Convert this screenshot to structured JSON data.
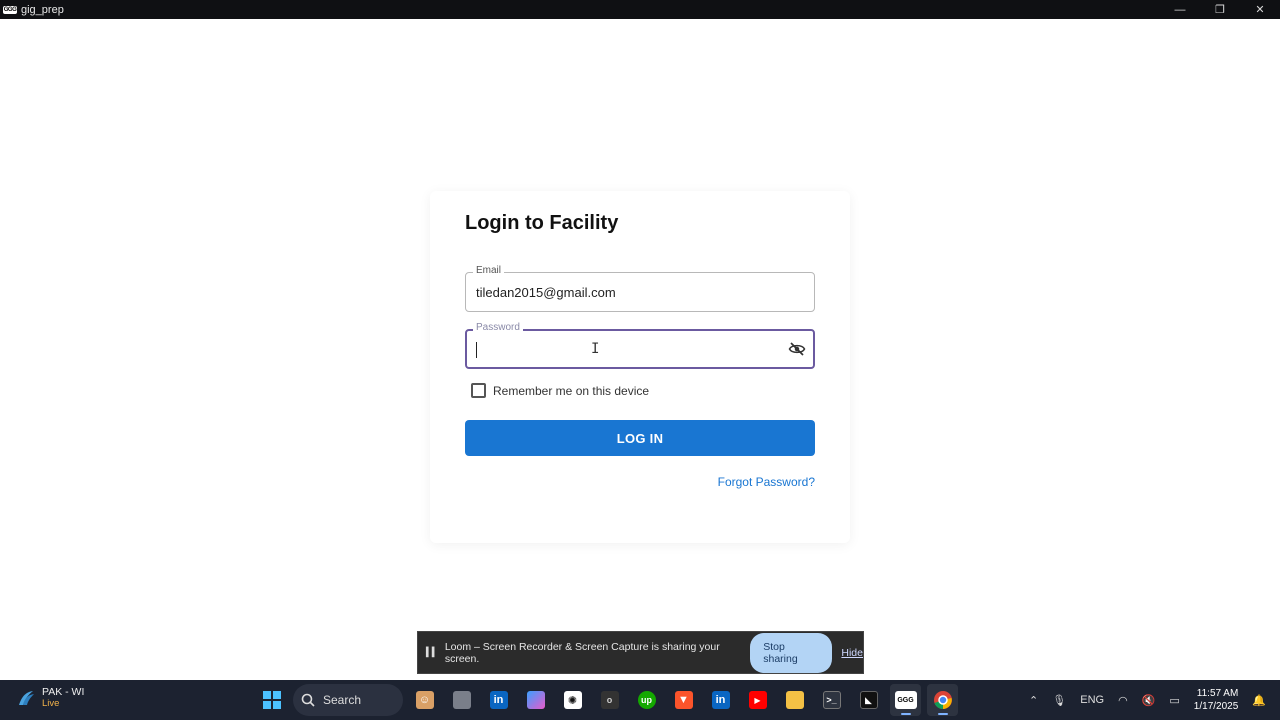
{
  "window": {
    "app_icon_text": "GGG",
    "title": "gig_prep",
    "minimize": "—",
    "restore": "❐",
    "close": "✕"
  },
  "login": {
    "heading": "Login to Facility",
    "email_label": "Email",
    "email_value": "tiledan2015@gmail.com",
    "password_label": "Password",
    "password_value": "",
    "remember_label": "Remember me on this device",
    "remember_checked": false,
    "login_button": "LOG IN",
    "forgot_link": "Forgot Password?"
  },
  "loom": {
    "message": "Loom – Screen Recorder & Screen Capture is sharing your screen.",
    "stop_button": "Stop sharing",
    "hide_link": "Hide"
  },
  "taskbar": {
    "weather_location": "PAK - WI",
    "weather_status": "Live",
    "search_label": "Search",
    "apps": [
      "start-icon",
      "search-icon",
      "people-icon",
      "file-explorer-icon",
      "linkedin-icon",
      "copilot-icon",
      "chatgpt-icon",
      "o-app-icon",
      "upwork-icon",
      "brave-icon",
      "linkedin-icon",
      "youtube-icon",
      "folder-icon",
      "terminal-icon",
      "cursor-icon",
      "ggg-icon",
      "chrome-icon"
    ],
    "language": "ENG",
    "time": "11:57 AM",
    "date": "1/17/2025"
  },
  "colors": {
    "primary": "#1976d2",
    "focus_border": "#6b5aa0",
    "taskbar": "#1c2230",
    "loom_stop": "#b3d4f5"
  }
}
